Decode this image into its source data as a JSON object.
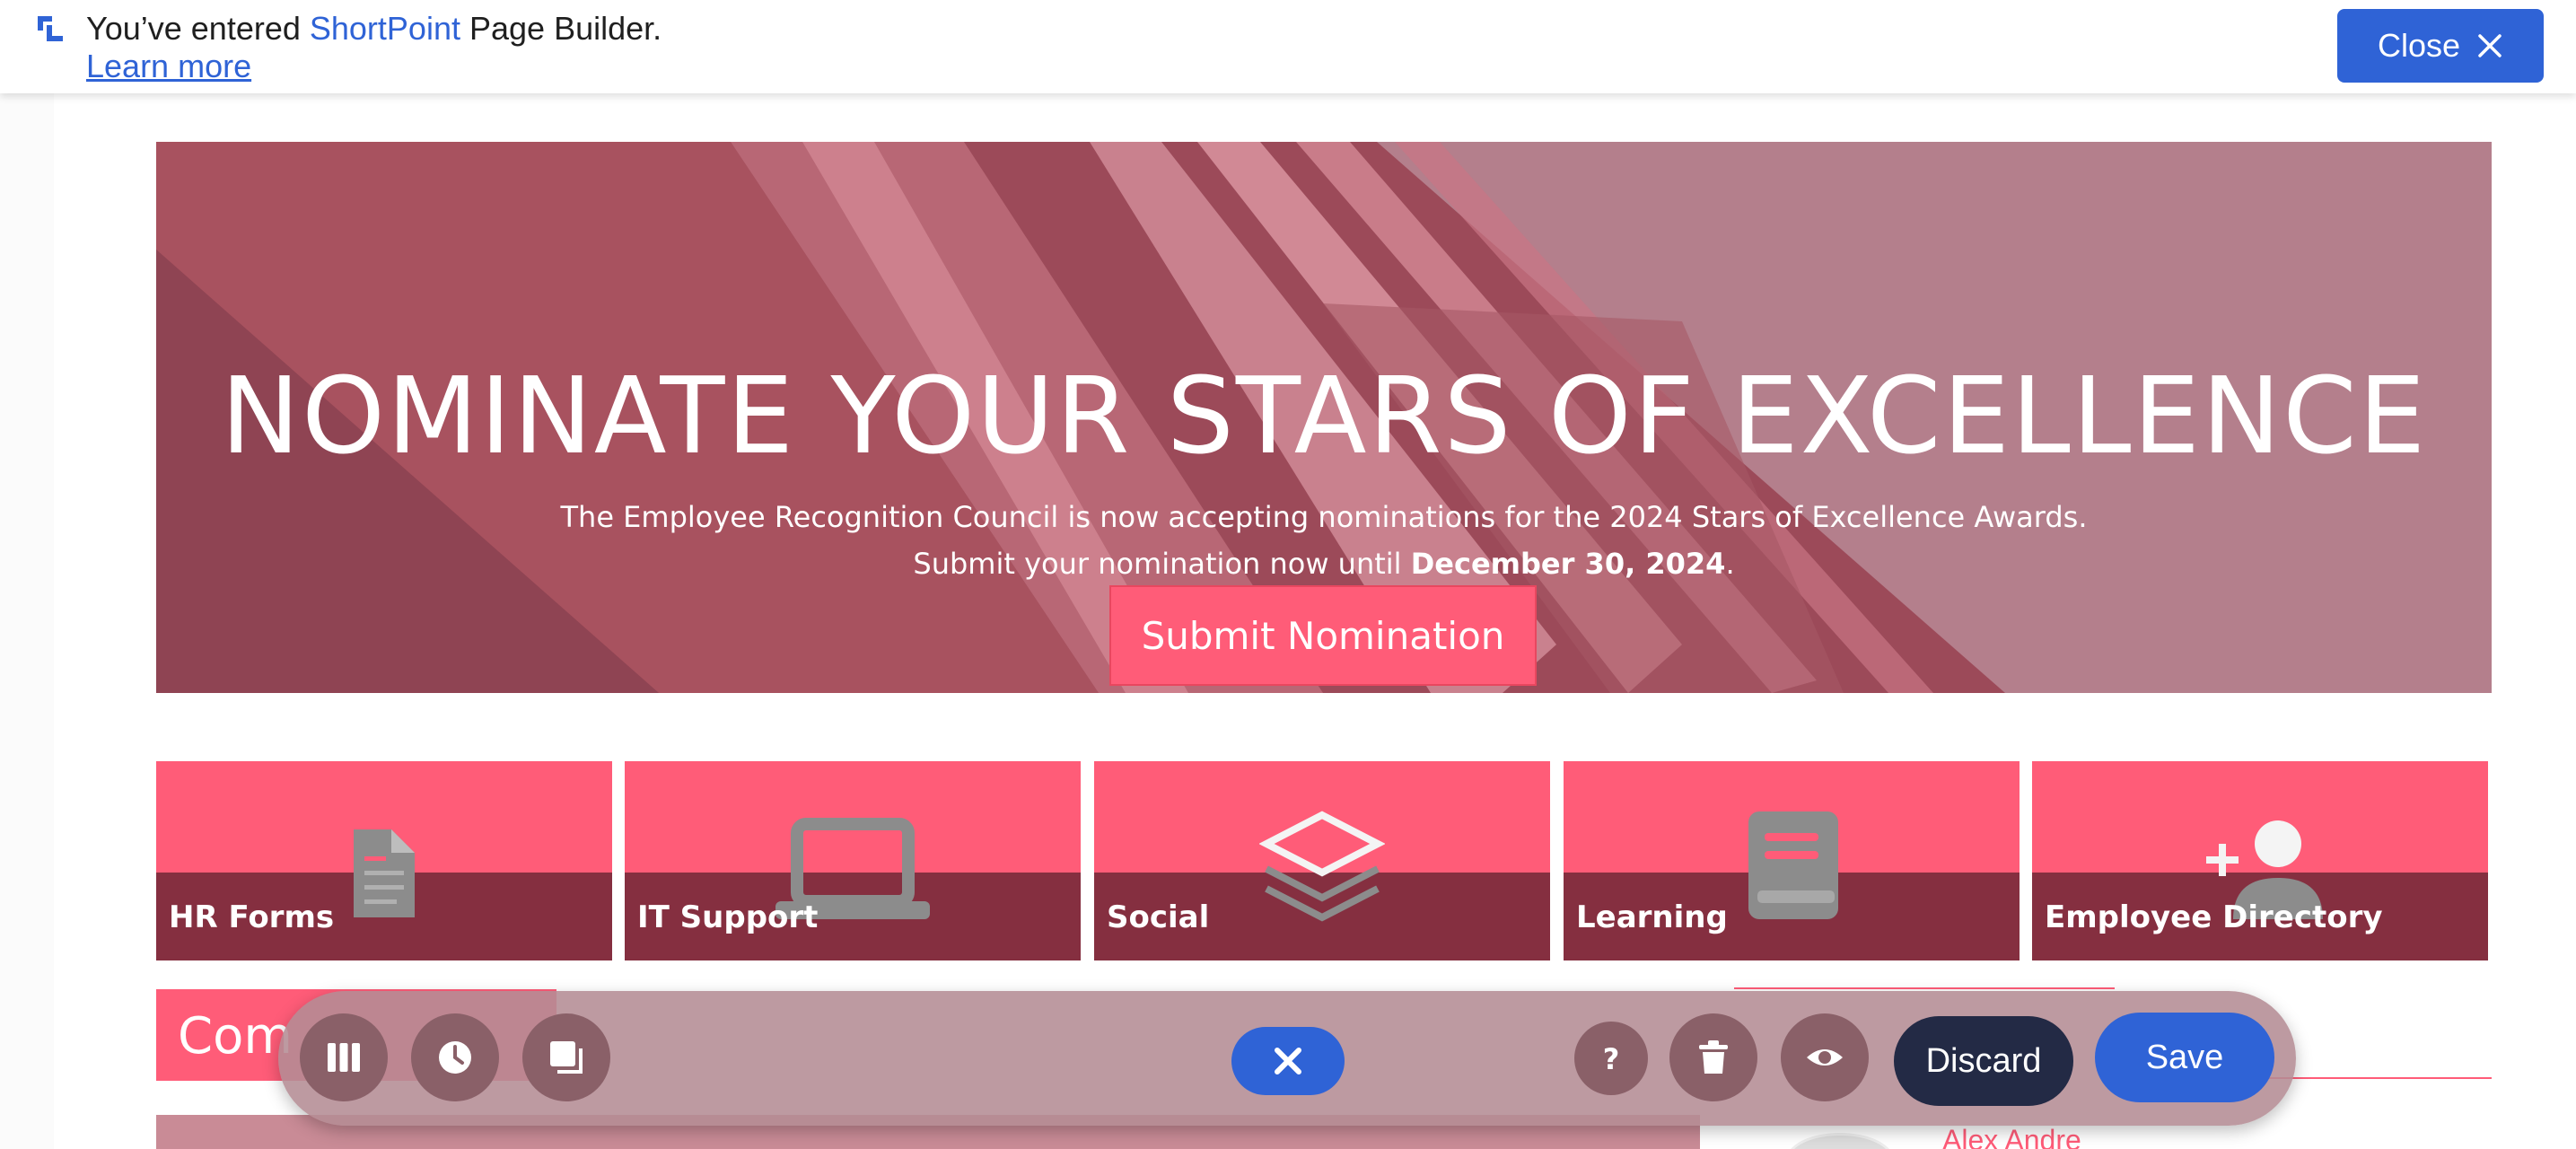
{
  "notice": {
    "prefix": "You’ve entered ",
    "brand": "ShortPoint",
    "suffix": " Page Builder.",
    "learn_more": "Learn more",
    "close_label": "Close"
  },
  "hero": {
    "title": "NOMINATE YOUR STARS OF EXCELLENCE",
    "line1": "The Employee Recognition Council is now accepting nominations for the 2024 Stars of Excellence Awards.",
    "line2_prefix": "Submit your nomination now until ",
    "line2_bold": "December 30, 2024",
    "line2_suffix": ".",
    "button": "Submit Nomination"
  },
  "tiles": [
    {
      "label": "HR Forms",
      "icon": "document-icon"
    },
    {
      "label": "IT Support",
      "icon": "laptop-icon"
    },
    {
      "label": "Social",
      "icon": "layers-icon"
    },
    {
      "label": "Learning",
      "icon": "book-icon"
    },
    {
      "label": "Employee Directory",
      "icon": "add-user-icon"
    }
  ],
  "lower": {
    "heading_partial": "Com",
    "person_name": "Alex Andre"
  },
  "toolbar": {
    "discard": "Discard",
    "save": "Save"
  },
  "colors": {
    "accent": "#2f63d6",
    "tile_pink": "#ff5c78",
    "tile_band": "#852f40",
    "discard_bg": "#232a45"
  }
}
